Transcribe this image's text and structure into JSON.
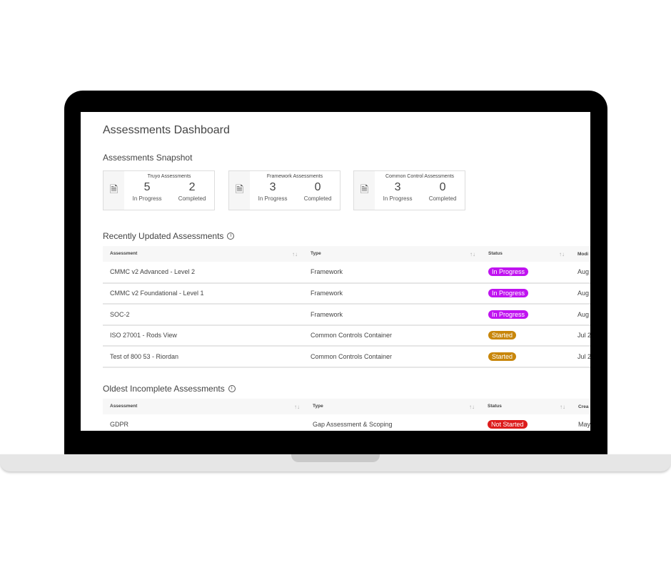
{
  "title": "Assessments Dashboard",
  "snapshot": {
    "heading": "Assessments Snapshot",
    "cards": [
      {
        "title": "Truyo Assessments",
        "in_progress": "5",
        "in_progress_label": "In Progress",
        "completed": "2",
        "completed_label": "Completed",
        "icon": "document-stack-icon"
      },
      {
        "title": "Framework Assessments",
        "in_progress": "3",
        "in_progress_label": "In Progress",
        "completed": "0",
        "completed_label": "Completed",
        "icon": "document-stack-icon"
      },
      {
        "title": "Common Control Assessments",
        "in_progress": "3",
        "in_progress_label": "In Progress",
        "completed": "0",
        "completed_label": "Completed",
        "icon": "document-stack-icon"
      }
    ]
  },
  "colors": {
    "in_progress": "#c013f0",
    "started": "#c8860a",
    "not_started": "#dd1c1c"
  },
  "recent": {
    "heading": "Recently Updated Assessments",
    "columns": [
      "Assessment",
      "Type",
      "Status",
      "Modi"
    ],
    "rows": [
      {
        "assessment": "CMMC v2 Advanced - Level 2",
        "type": "Framework",
        "status": "In Progress",
        "status_key": "in_progress",
        "date": "Aug"
      },
      {
        "assessment": "CMMC v2 Foundational - Level 1",
        "type": "Framework",
        "status": "In Progress",
        "status_key": "in_progress",
        "date": "Aug"
      },
      {
        "assessment": "SOC-2",
        "type": "Framework",
        "status": "In Progress",
        "status_key": "in_progress",
        "date": "Aug"
      },
      {
        "assessment": "ISO 27001 - Rods View",
        "type": "Common Controls Container",
        "status": "Started",
        "status_key": "started",
        "date": "Jul 2"
      },
      {
        "assessment": "Test of 800 53 - Riordan",
        "type": "Common Controls Container",
        "status": "Started",
        "status_key": "started",
        "date": "Jul 2"
      }
    ]
  },
  "oldest": {
    "heading": "Oldest Incomplete Assessments",
    "columns": [
      "Assessment",
      "Type",
      "Status",
      "Crea"
    ],
    "rows": [
      {
        "assessment": "GDPR",
        "type": "Gap Assessment & Scoping",
        "status": "Not Started",
        "status_key": "not_started",
        "date": "May"
      }
    ]
  }
}
